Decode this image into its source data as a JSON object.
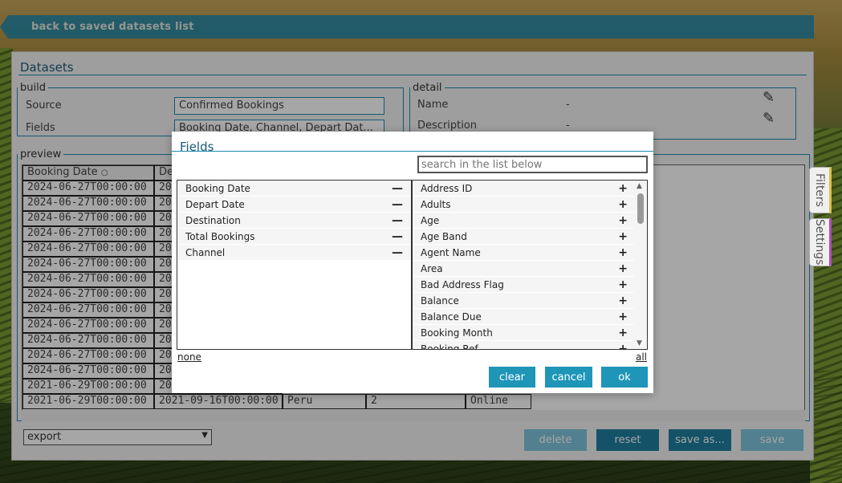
{
  "back_link": "back to saved datasets list",
  "panel": {
    "title": "Datasets",
    "build": {
      "legend": "build",
      "source_label": "Source",
      "source_value": "Confirmed Bookings",
      "fields_label": "Fields",
      "fields_value": "Booking Date, Channel, Depart Dat..."
    },
    "detail": {
      "legend": "detail",
      "name_label": "Name",
      "name_value": "-",
      "description_label": "Description",
      "description_value": "-"
    },
    "preview": {
      "legend": "preview",
      "header": [
        "Booking Date",
        "De"
      ],
      "rows": [
        [
          "2024-06-27T00:00:00",
          "20"
        ],
        [
          "2024-06-27T00:00:00",
          "20"
        ],
        [
          "2024-06-27T00:00:00",
          "20"
        ],
        [
          "2024-06-27T00:00:00",
          "20"
        ],
        [
          "2024-06-27T00:00:00",
          "20"
        ],
        [
          "2024-06-27T00:00:00",
          "20"
        ],
        [
          "2024-06-27T00:00:00",
          "20"
        ],
        [
          "2024-06-27T00:00:00",
          "20"
        ],
        [
          "2024-06-27T00:00:00",
          "20"
        ],
        [
          "2024-06-27T00:00:00",
          "20"
        ],
        [
          "2024-06-27T00:00:00",
          "20"
        ],
        [
          "2024-06-27T00:00:00",
          "20"
        ],
        [
          "2024-06-27T00:00:00",
          "20"
        ],
        [
          "2021-06-29T00:00:00",
          "20"
        ]
      ],
      "last_row": [
        "2021-06-29T00:00:00",
        "2021-09-16T00:00:00",
        "Peru",
        "2",
        "Online"
      ]
    },
    "export_label": "export",
    "buttons": {
      "delete": "delete",
      "reset": "reset",
      "save_as": "save as...",
      "save": "save"
    }
  },
  "side_tabs": {
    "filters": "Filters",
    "settings": "Settings"
  },
  "modal": {
    "title": "Fields",
    "search_placeholder": "search in the list below",
    "selected": [
      "Booking Date",
      "Depart Date",
      "Destination",
      "Total Bookings",
      "Channel"
    ],
    "available": [
      "Address ID",
      "Adults",
      "Age",
      "Age Band",
      "Agent Name",
      "Area",
      "Bad Address Flag",
      "Balance",
      "Balance Due",
      "Booking Month",
      "Booking Ref"
    ],
    "none_link": "none",
    "all_link": "all",
    "clear": "clear",
    "cancel": "cancel",
    "ok": "ok"
  },
  "colors": {
    "accent": "#1f96b8",
    "title": "#1b5a78"
  }
}
